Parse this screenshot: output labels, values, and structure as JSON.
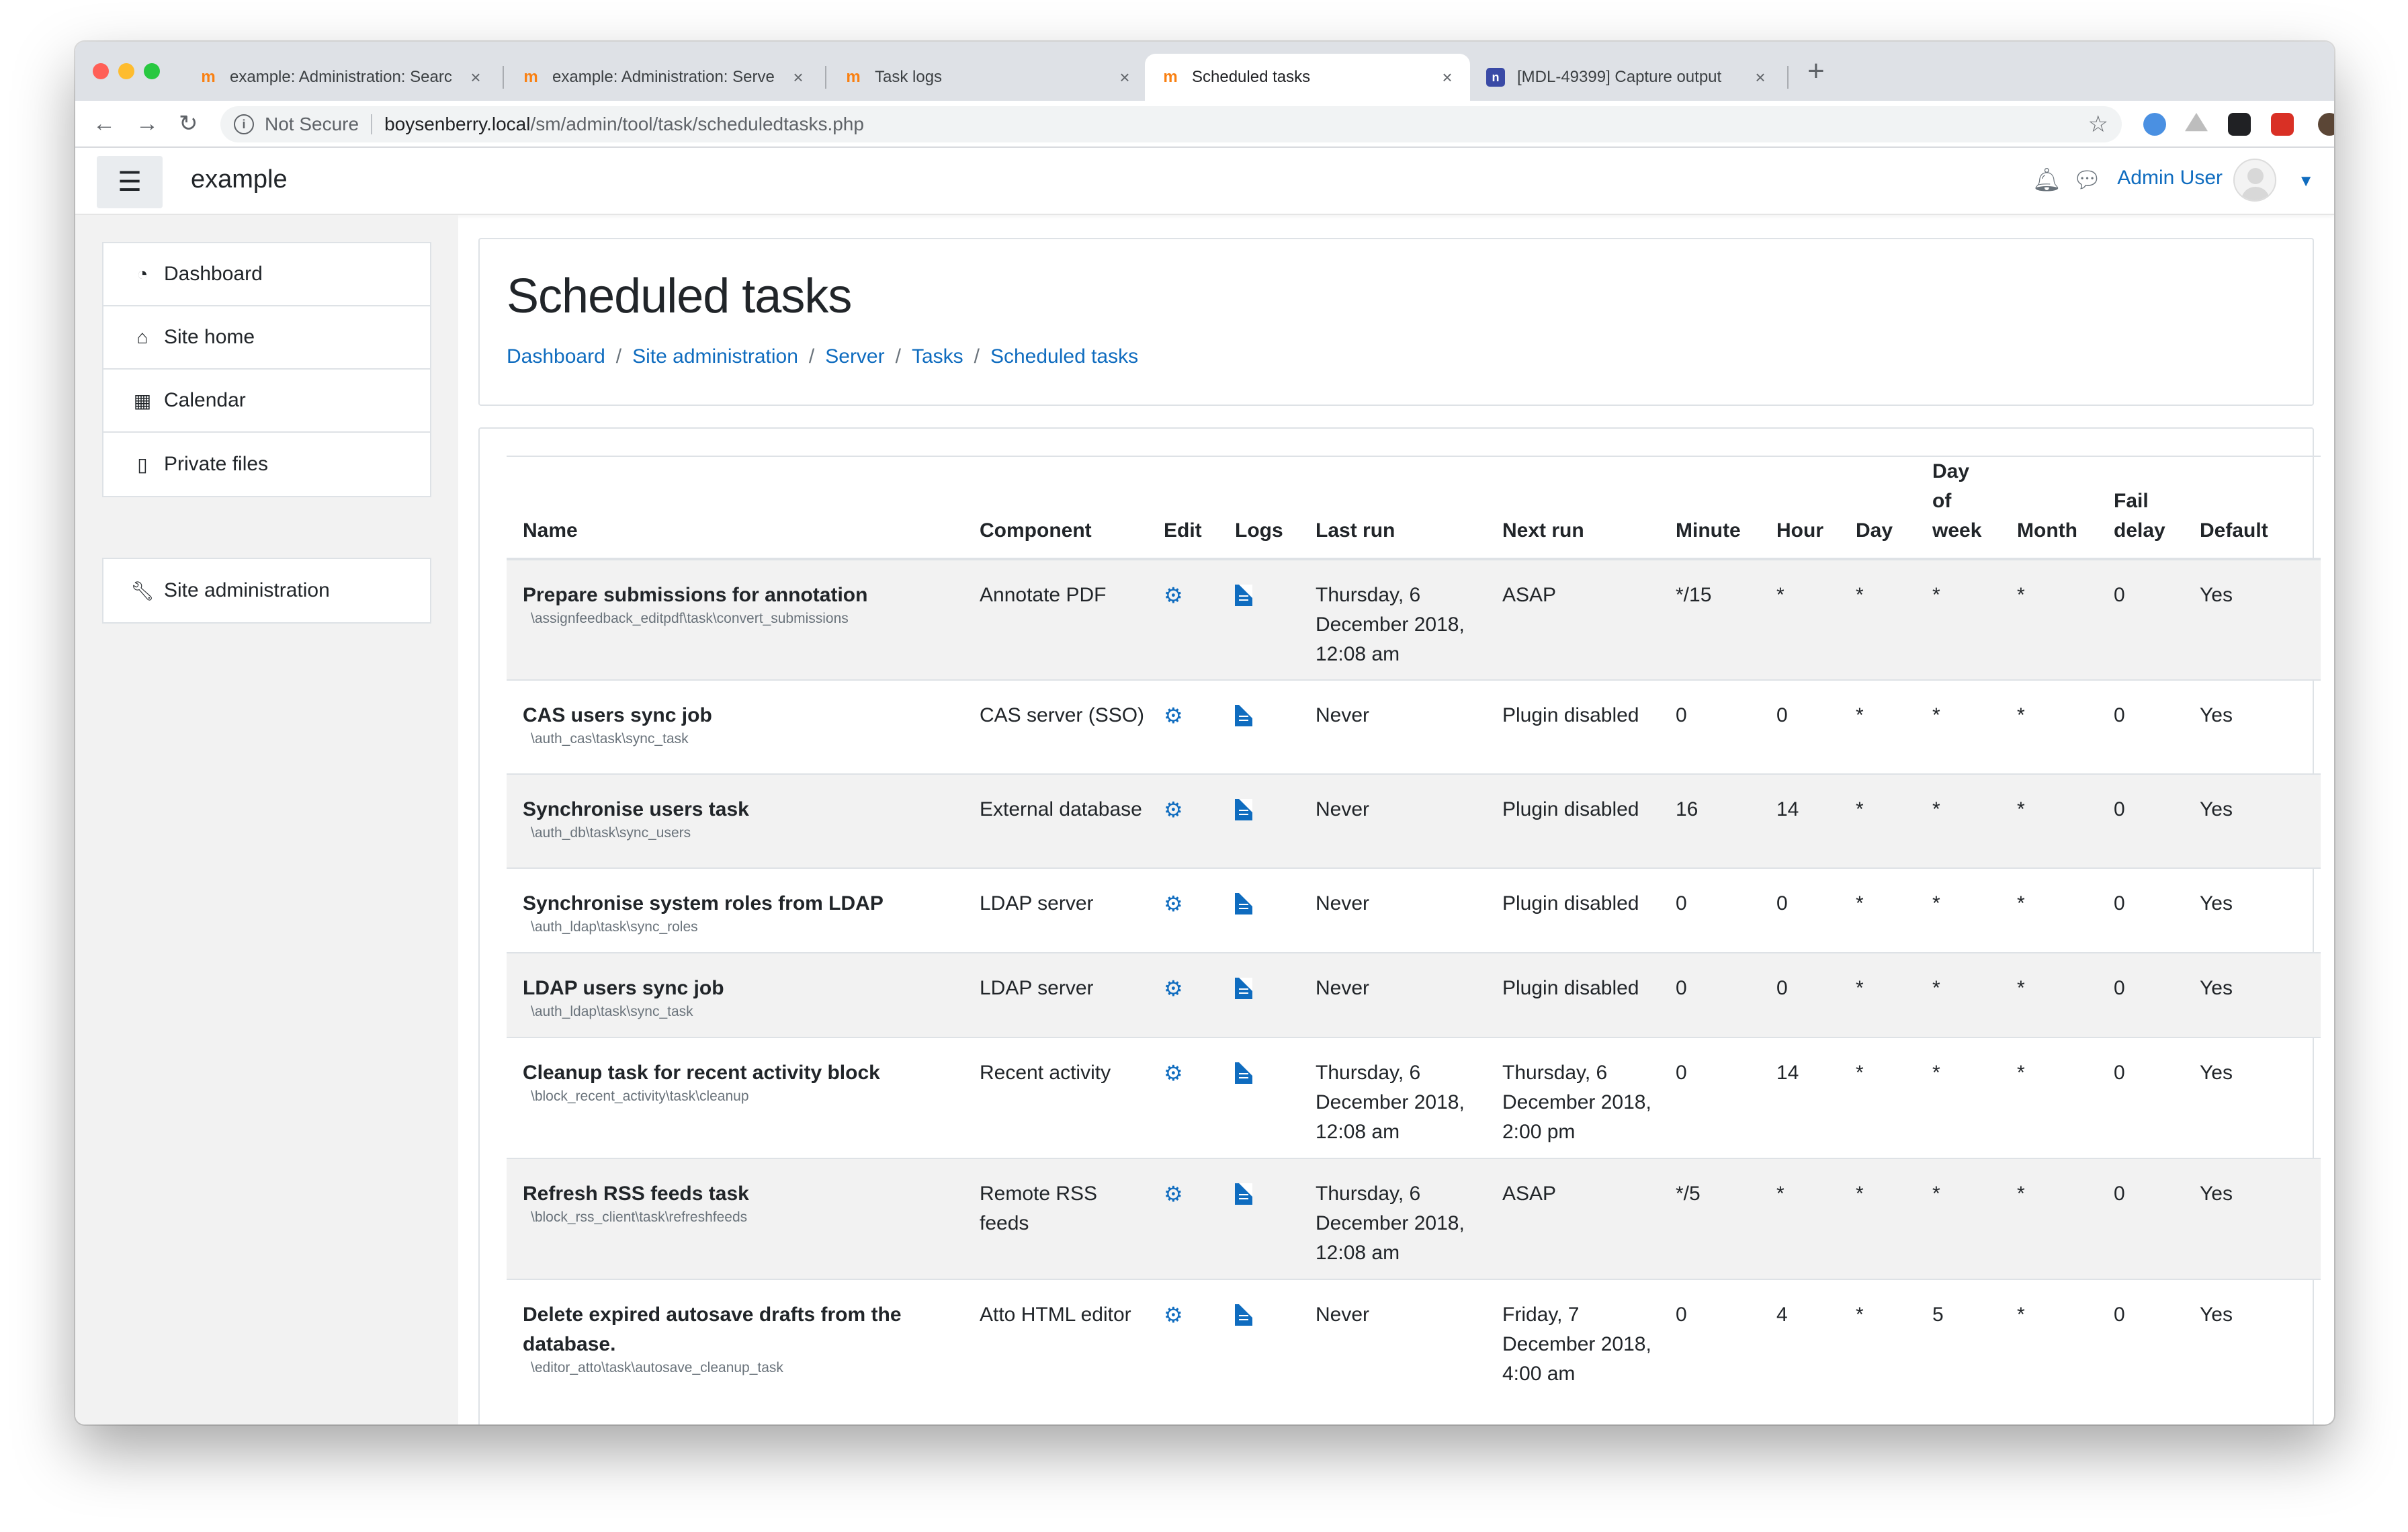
{
  "browser": {
    "tabs": [
      {
        "title": "example: Administration: Searc",
        "favicon": "moodle-icon"
      },
      {
        "title": "example: Administration: Serve",
        "favicon": "moodle-icon"
      },
      {
        "title": "Task logs",
        "favicon": "moodle-icon"
      },
      {
        "title": "Scheduled tasks",
        "favicon": "moodle-icon",
        "active": true
      },
      {
        "title": "[MDL-49399] Capture output",
        "favicon": "jira-icon"
      }
    ],
    "security_label": "Not Secure",
    "url_host": "boysenberry.local",
    "url_path": "/sm/admin/tool/task/scheduledtasks.php"
  },
  "header": {
    "site_name": "example",
    "user_name": "Admin User"
  },
  "nav": {
    "items": [
      {
        "label": "Dashboard",
        "icon": "dashboard-icon"
      },
      {
        "label": "Site home",
        "icon": "home-icon"
      },
      {
        "label": "Calendar",
        "icon": "calendar-icon"
      },
      {
        "label": "Private files",
        "icon": "file-icon"
      }
    ],
    "admin_label": "Site administration"
  },
  "page": {
    "title": "Scheduled tasks",
    "breadcrumb": [
      "Dashboard",
      "Site administration",
      "Server",
      "Tasks",
      "Scheduled tasks"
    ]
  },
  "table": {
    "headers": {
      "name": "Name",
      "component": "Component",
      "edit": "Edit",
      "logs": "Logs",
      "lastrun": "Last run",
      "nextrun": "Next run",
      "minute": "Minute",
      "hour": "Hour",
      "day": "Day",
      "dayofweek": [
        "Day",
        "of",
        "week"
      ],
      "month": "Month",
      "faildelay": [
        "Fail",
        "delay"
      ],
      "default": "Default"
    },
    "rows": [
      {
        "name": "Prepare submissions for annotation",
        "classname": "\\assignfeedback_editpdf\\task\\convert_submissions",
        "component": "Annotate PDF",
        "lastrun": "Thursday, 6 December 2018, 12:08 am",
        "nextrun": "ASAP",
        "minute": "*/15",
        "hour": "*",
        "day": "*",
        "dayofweek": "*",
        "month": "*",
        "faildelay": "0",
        "default": "Yes"
      },
      {
        "name": "CAS users sync job",
        "classname": "\\auth_cas\\task\\sync_task",
        "component": "CAS server (SSO)",
        "lastrun": "Never",
        "nextrun": "Plugin disabled",
        "minute": "0",
        "hour": "0",
        "day": "*",
        "dayofweek": "*",
        "month": "*",
        "faildelay": "0",
        "default": "Yes"
      },
      {
        "name": "Synchronise users task",
        "classname": "\\auth_db\\task\\sync_users",
        "component": "External database",
        "lastrun": "Never",
        "nextrun": "Plugin disabled",
        "minute": "16",
        "hour": "14",
        "day": "*",
        "dayofweek": "*",
        "month": "*",
        "faildelay": "0",
        "default": "Yes"
      },
      {
        "name": "Synchronise system roles from LDAP",
        "classname": "\\auth_ldap\\task\\sync_roles",
        "component": "LDAP server",
        "lastrun": "Never",
        "nextrun": "Plugin disabled",
        "minute": "0",
        "hour": "0",
        "day": "*",
        "dayofweek": "*",
        "month": "*",
        "faildelay": "0",
        "default": "Yes"
      },
      {
        "name": "LDAP users sync job",
        "classname": "\\auth_ldap\\task\\sync_task",
        "component": "LDAP server",
        "lastrun": "Never",
        "nextrun": "Plugin disabled",
        "minute": "0",
        "hour": "0",
        "day": "*",
        "dayofweek": "*",
        "month": "*",
        "faildelay": "0",
        "default": "Yes"
      },
      {
        "name": "Cleanup task for recent activity block",
        "classname": "\\block_recent_activity\\task\\cleanup",
        "component": "Recent activity",
        "lastrun": "Thursday, 6 December 2018, 12:08 am",
        "nextrun": "Thursday, 6 December 2018, 2:00 pm",
        "minute": "0",
        "hour": "14",
        "day": "*",
        "dayofweek": "*",
        "month": "*",
        "faildelay": "0",
        "default": "Yes"
      },
      {
        "name": "Refresh RSS feeds task",
        "classname": "\\block_rss_client\\task\\refreshfeeds",
        "component": "Remote RSS feeds",
        "lastrun": "Thursday, 6 December 2018, 12:08 am",
        "nextrun": "ASAP",
        "minute": "*/5",
        "hour": "*",
        "day": "*",
        "dayofweek": "*",
        "month": "*",
        "faildelay": "0",
        "default": "Yes"
      },
      {
        "name": "Delete expired autosave drafts from the database.",
        "classname": "\\editor_atto\\task\\autosave_cleanup_task",
        "component": "Atto HTML editor",
        "lastrun": "Never",
        "nextrun": "Friday, 7 December 2018, 4:00 am",
        "minute": "0",
        "hour": "4",
        "day": "*",
        "dayofweek": "5",
        "month": "*",
        "faildelay": "0",
        "default": "Yes"
      }
    ]
  }
}
